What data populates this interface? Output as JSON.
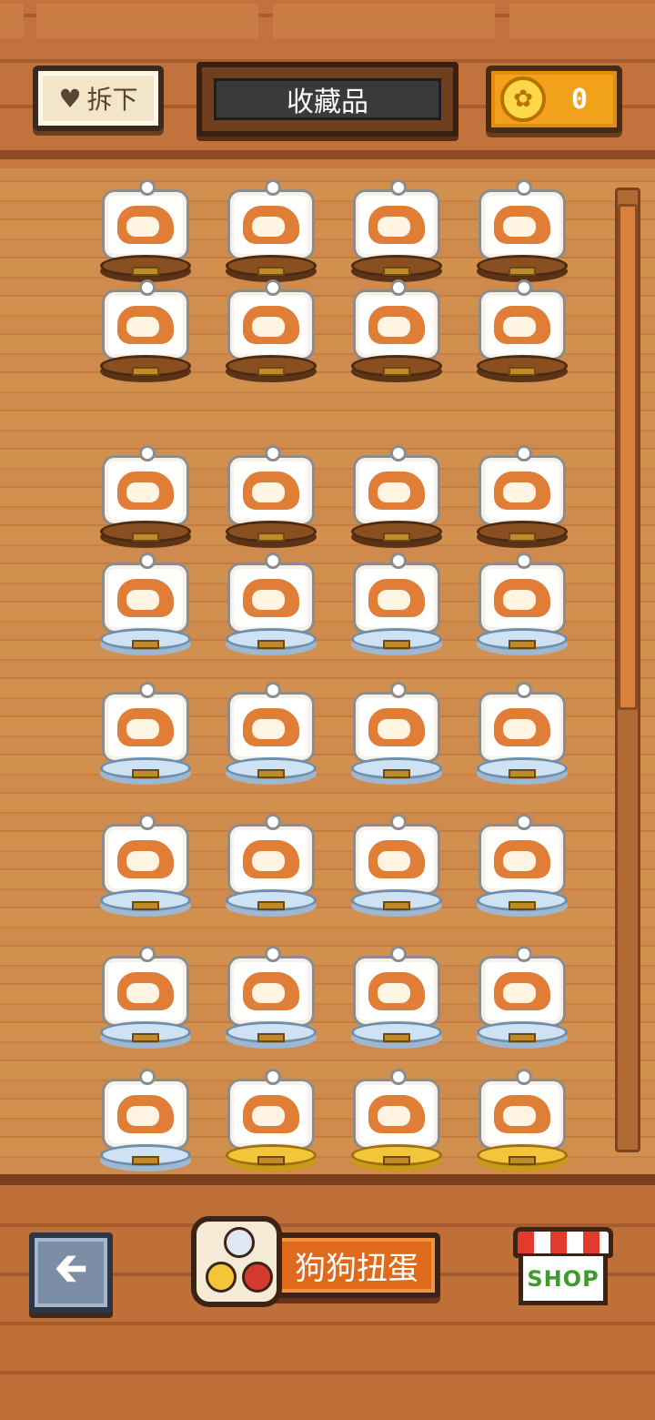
{
  "header": {
    "detach_label": "拆下",
    "title": "收藏品",
    "coins": "0"
  },
  "footer": {
    "gacha_label": "狗狗扭蛋",
    "shop_label": "SHOP"
  },
  "icons": {
    "detach": "heart-icon",
    "coin": "paw-coin-icon",
    "back": "arrow-left-icon",
    "gacha": "capsule-balls-icon",
    "shop": "shop-awning-icon"
  },
  "colors": {
    "wood_base": "#8a4f20",
    "glass_base": "#cfe2f3",
    "gold_base": "#f3c53a",
    "coin_accent": "#f2a21a",
    "gacha_accent": "#e06a1c",
    "shop_text": "#3f9b2c"
  },
  "collection": [
    {
      "row": 1,
      "base": "wood"
    },
    {
      "row": 1,
      "base": "wood"
    },
    {
      "row": 1,
      "base": "wood"
    },
    {
      "row": 1,
      "base": "wood"
    },
    {
      "row": 2,
      "base": "wood"
    },
    {
      "row": 2,
      "base": "wood"
    },
    {
      "row": 2,
      "base": "wood"
    },
    {
      "row": 2,
      "base": "wood"
    },
    {
      "row": 3,
      "base": "wood"
    },
    {
      "row": 3,
      "base": "wood"
    },
    {
      "row": 3,
      "base": "wood"
    },
    {
      "row": 3,
      "base": "wood"
    },
    {
      "row": 4,
      "base": "glass"
    },
    {
      "row": 4,
      "base": "glass"
    },
    {
      "row": 4,
      "base": "glass"
    },
    {
      "row": 4,
      "base": "glass"
    },
    {
      "row": 5,
      "base": "glass"
    },
    {
      "row": 5,
      "base": "glass"
    },
    {
      "row": 5,
      "base": "glass"
    },
    {
      "row": 5,
      "base": "glass"
    },
    {
      "row": 6,
      "base": "glass"
    },
    {
      "row": 6,
      "base": "glass"
    },
    {
      "row": 6,
      "base": "glass"
    },
    {
      "row": 6,
      "base": "glass"
    },
    {
      "row": 7,
      "base": "glass"
    },
    {
      "row": 7,
      "base": "glass"
    },
    {
      "row": 7,
      "base": "glass"
    },
    {
      "row": 7,
      "base": "glass"
    },
    {
      "row": 8,
      "base": "glass"
    },
    {
      "row": 8,
      "base": "gold"
    },
    {
      "row": 8,
      "base": "gold"
    },
    {
      "row": 8,
      "base": "gold"
    }
  ]
}
